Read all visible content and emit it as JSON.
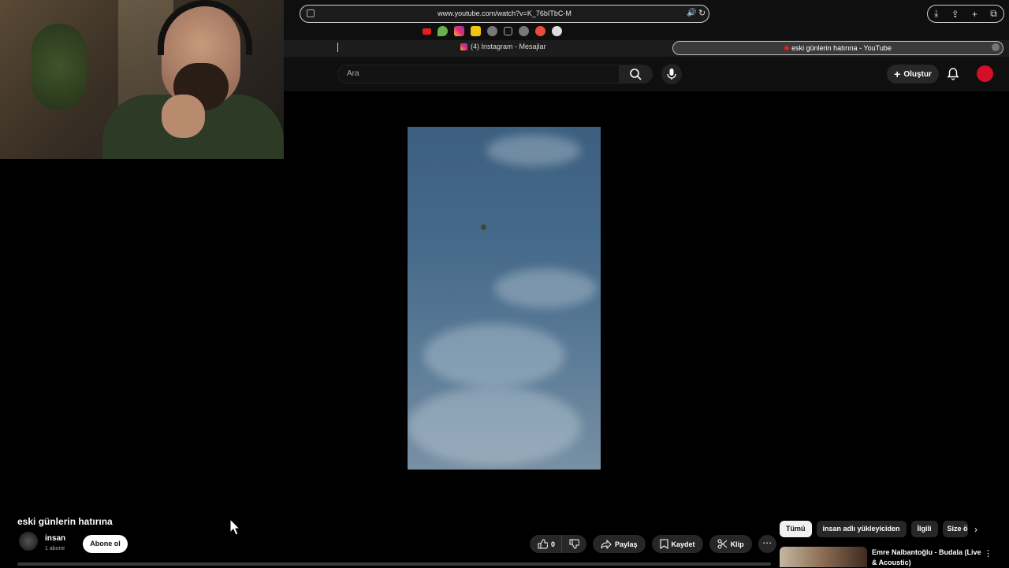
{
  "browser": {
    "url": "www.youtube.com/watch?v=K_76bITbC-M",
    "tabs": [
      {
        "label": "(4) Instagram - Mesajlar"
      },
      {
        "label": "eski günlerin hatırına - YouTube"
      }
    ],
    "favorites_icons": [
      "youtube-icon",
      "drop-icon",
      "instagram-icon",
      "note-icon",
      "globe-icon",
      "f-icon",
      "globe-icon",
      "avatar-icon",
      "openai-icon"
    ]
  },
  "yt_header": {
    "search_placeholder": "Ara",
    "create_label": "Oluştur"
  },
  "video": {
    "title": "eski günlerin hatırına",
    "channel_name": "insan",
    "subscribers": "1 abone",
    "subscribe_label": "Abone ol",
    "likes": "0",
    "share_label": "Paylaş",
    "save_label": "Kaydet",
    "clip_label": "Klip"
  },
  "chips": [
    "Tümü",
    "insan adlı yükleyiciden",
    "İlgili",
    "Size ö"
  ],
  "recommendation": {
    "title": "Emre Nalbantoğlu - Budala (Live & Acoustic)"
  },
  "colors": {
    "background": "#000000",
    "accent_red": "#d40f2a",
    "chip_active": "#f1f1f1"
  }
}
